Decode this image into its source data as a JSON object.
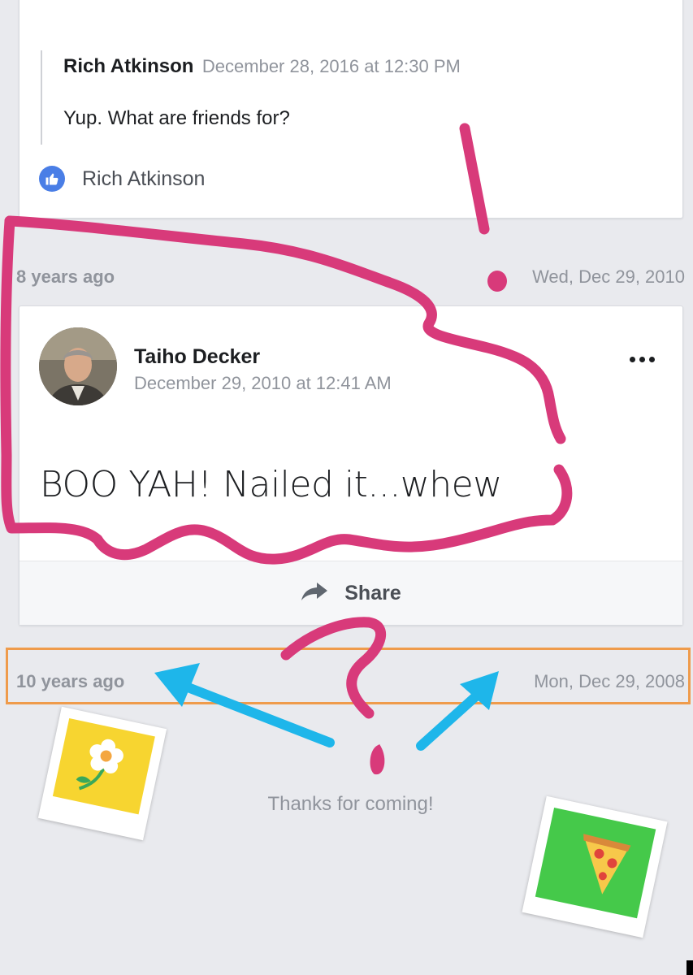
{
  "top_comment": {
    "reply_author": "Rich Atkinson",
    "reply_time": "December 28, 2016 at 12:30 PM",
    "reply_text": "Yup. What are friends for?",
    "liked_by": "Rich Atkinson"
  },
  "row_8": {
    "ago": "8 years ago",
    "date": "Wed, Dec 29, 2010"
  },
  "post": {
    "author": "Taiho Decker",
    "time": "December 29, 2010 at 12:41 AM",
    "text": "BOO YAH! Nailed it...whew",
    "share_label": "Share"
  },
  "row_10": {
    "ago": "10 years ago",
    "date": "Mon, Dec 29, 2008"
  },
  "footer": {
    "thanks": "Thanks for coming!"
  },
  "colors": {
    "annotation_pink": "#d83a7a",
    "annotation_orange": "#ef9b4b",
    "annotation_blue": "#1eb6ea",
    "like_blue": "#4a7ee6"
  },
  "icons": [
    "thumbs-up-icon",
    "share-arrow-icon",
    "more-options-icon",
    "flower-icon",
    "pizza-icon"
  ]
}
